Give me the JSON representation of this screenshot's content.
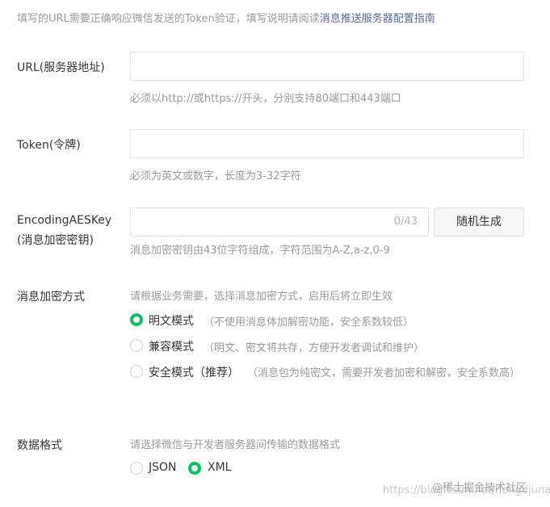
{
  "intro": {
    "text": "填写的URL需要正确响应微信发送的Token验证，填写说明请阅读",
    "link": "消息推送服务器配置指南"
  },
  "url": {
    "label": "URL(服务器地址)",
    "value": "",
    "hint": "必须以http://或https://开头，分别支持80端口和443端口"
  },
  "token": {
    "label": "Token(令牌)",
    "value": "",
    "hint": "必须为英文或数字，长度为3-32字符"
  },
  "aes": {
    "label_line1": "EncodingAESKey",
    "label_line2": "(消息加密密钥)",
    "value": "",
    "counter": "0/43",
    "generate_button": "随机生成",
    "hint": "消息加密密钥由43位字符组成，字符范围为A-Z,a-z,0-9"
  },
  "encryption": {
    "label": "消息加密方式",
    "hint": "请根据业务需要，选择消息加密方式，启用后将立即生效",
    "options": [
      {
        "label": "明文模式",
        "desc": "（不使用消息体加解密功能，安全系数较低）",
        "selected": true
      },
      {
        "label": "兼容模式",
        "desc": "（明文、密文将共存，方便开发者调试和维护）",
        "selected": false
      },
      {
        "label": "安全模式（推荐）",
        "desc": "（消息包为纯密文，需要开发者加密和解密，安全系数高）",
        "selected": false
      }
    ]
  },
  "format": {
    "label": "数据格式",
    "hint": "请选择微信与开发者服务器间传输的数据格式",
    "options": [
      {
        "label": "JSON",
        "selected": false
      },
      {
        "label": "XML",
        "selected": true
      }
    ]
  },
  "watermark": {
    "url": "https://blog.csdn.net/hongdjuna",
    "site": "@稀土掘金技术社区"
  },
  "colors": {
    "accent": "#07c160",
    "link": "#576b95",
    "hint": "#9a9a9a"
  }
}
